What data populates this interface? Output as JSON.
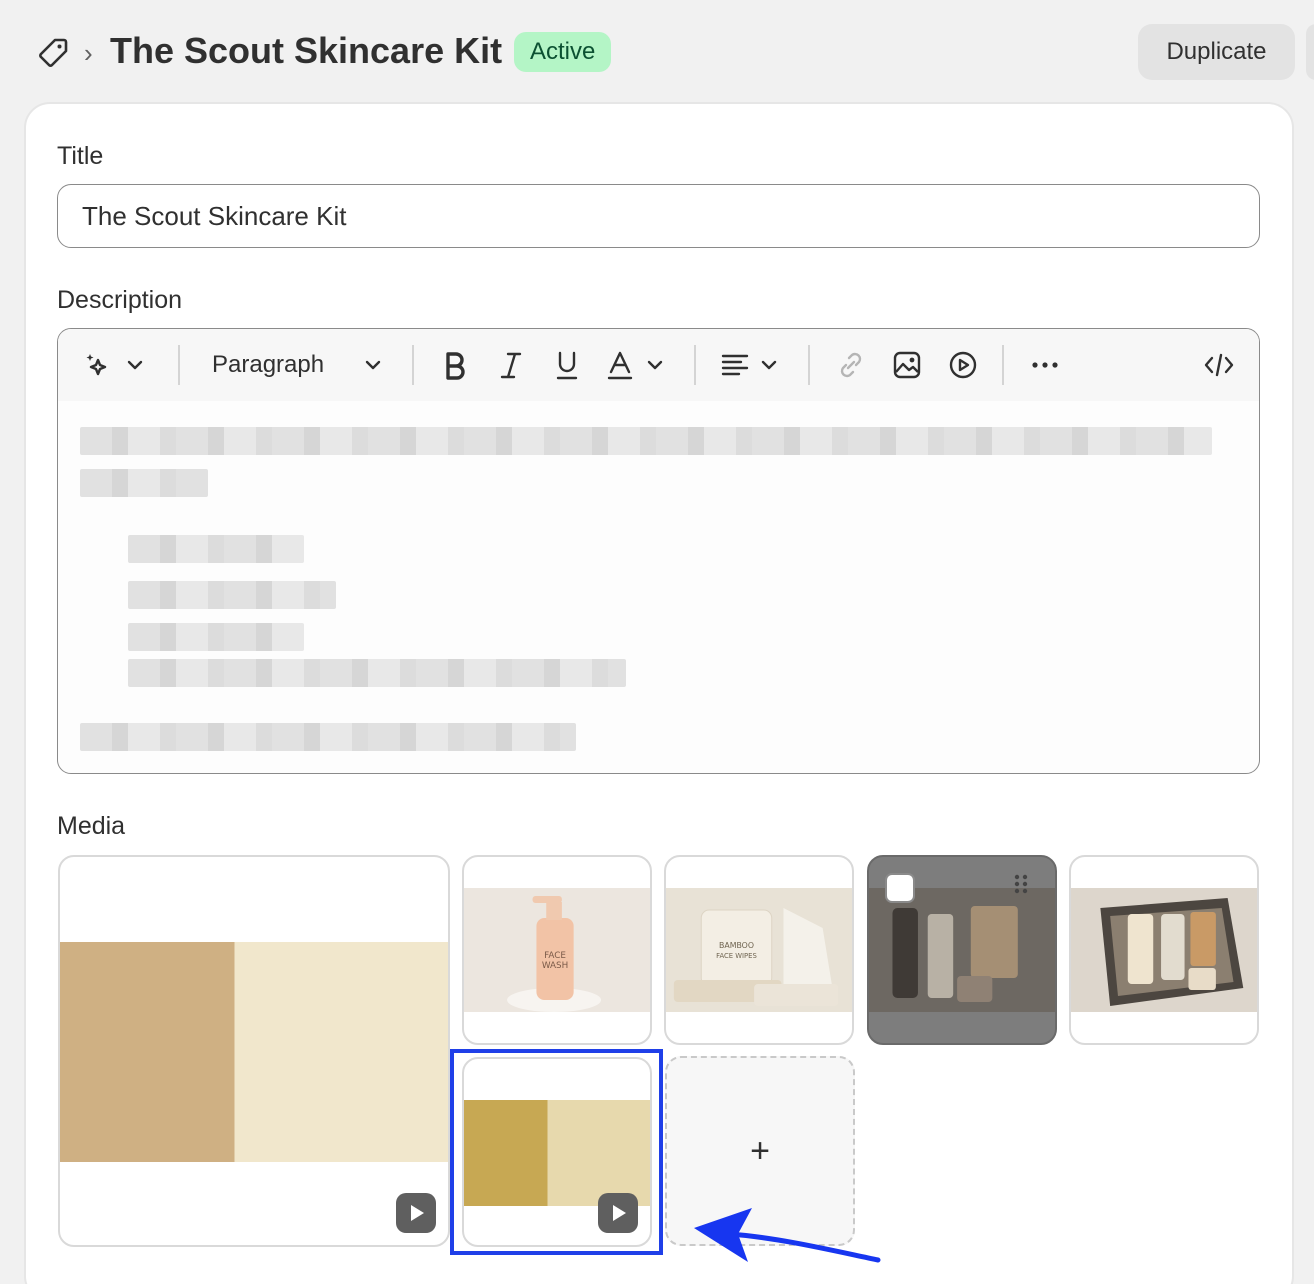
{
  "header": {
    "breadcrumb_separator": "›",
    "title": "The Scout Skincare Kit",
    "status": "Active",
    "duplicate_label": "Duplicate"
  },
  "form": {
    "title_label": "Title",
    "title_value": "The Scout Skincare Kit",
    "description_label": "Description",
    "media_label": "Media",
    "add_media_label": "+"
  },
  "toolbar": {
    "paragraph_label": "Paragraph",
    "icons": [
      "magic-icon",
      "bold-icon",
      "italic-icon",
      "underline-icon",
      "text-color-icon",
      "align-icon",
      "link-icon",
      "image-icon",
      "video-icon",
      "more-icon",
      "code-icon"
    ]
  },
  "media": {
    "items": [
      {
        "kind": "video",
        "description": "split tan color tile"
      },
      {
        "kind": "image",
        "product": "FACE WASH pump bottle"
      },
      {
        "kind": "image",
        "product": "BAMBOO FACE WIPES"
      },
      {
        "kind": "image",
        "product": "kit products",
        "selected_overlay": true
      },
      {
        "kind": "image",
        "product": "tin gift box"
      },
      {
        "kind": "video",
        "description": "split gold color tile"
      }
    ]
  },
  "colors": {
    "status_bg": "#b4f5c6",
    "status_text": "#0c5132",
    "selection": "#1f3fe8",
    "arrow": "#1736f0"
  }
}
